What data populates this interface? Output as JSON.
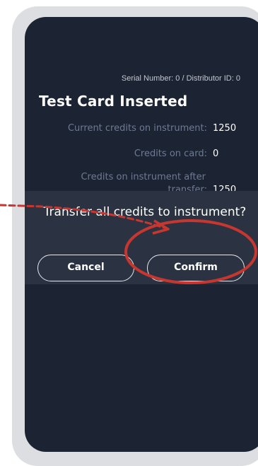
{
  "device": {
    "serial_line": "Serial Number: 0 / Distributor ID: 0",
    "title": "Test Card Inserted",
    "rows": [
      {
        "label": "Current credits on instrument:",
        "value": "1250"
      },
      {
        "label": "Credits on card:",
        "value": "0"
      },
      {
        "label_line1": "Credits on instrument after",
        "label_line2": "transfer:",
        "value": "1250"
      }
    ]
  },
  "dialog": {
    "prompt": "Transfer all credits to instrument?",
    "cancel_label": "Cancel",
    "confirm_label": "Confirm"
  },
  "colors": {
    "screen_bg": "#1c2332",
    "dialog_bg": "#2b3342",
    "muted_text": "#6e7a93",
    "annotation_red": "#c8372f"
  },
  "annotation": {
    "type": "red-dashed-arrow-with-circle",
    "target": "confirm-button"
  }
}
